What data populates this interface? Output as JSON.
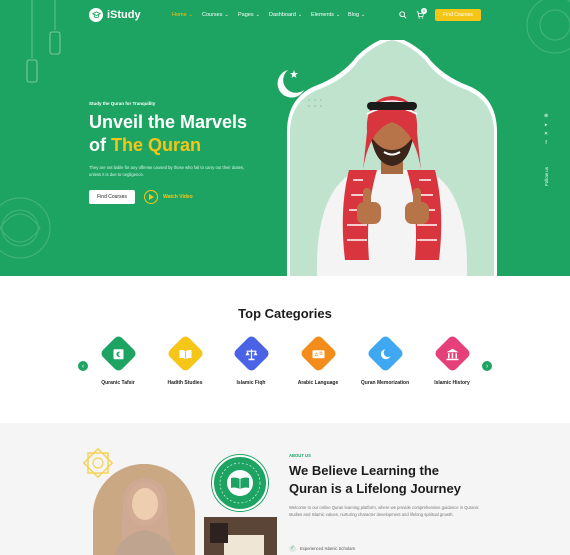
{
  "brand": {
    "name": "iStudy",
    "accent": "#1da462",
    "highlight": "#f5c518"
  },
  "nav": {
    "items": [
      {
        "label": "Home",
        "active": true
      },
      {
        "label": "Courses",
        "active": false
      },
      {
        "label": "Pages",
        "active": false
      },
      {
        "label": "Dashboard",
        "active": false
      },
      {
        "label": "Elements",
        "active": false
      },
      {
        "label": "Blog",
        "active": false
      }
    ],
    "cart_count": "0",
    "cta": "Find Courses"
  },
  "hero": {
    "kicker": "Study the Quran for Tranquility",
    "title_line1": "Unveil the Marvels",
    "title_line2_prefix": "of ",
    "title_line2_highlight": "The Quran",
    "description": "They are not liable for any offense caused by those who fail to carry out their duties, unless it is due to negligence.",
    "primary_button": "Find Courses",
    "video_button": "Watch Video",
    "follow_label": "Follow us"
  },
  "categories": {
    "title": "Top Categories",
    "items": [
      {
        "label": "Quranic Tafsir",
        "color": "#1da462",
        "icon": "quran-icon"
      },
      {
        "label": "Hadith Studies",
        "color": "#f5c518",
        "icon": "book-open-icon"
      },
      {
        "label": "Islamic Fiqh",
        "color": "#4a63e6",
        "icon": "scales-icon"
      },
      {
        "label": "Arabic Language",
        "color": "#f28c1a",
        "icon": "language-icon"
      },
      {
        "label": "Quran Memorization",
        "color": "#3fa8f0",
        "icon": "crescent-icon"
      },
      {
        "label": "Islamic History",
        "color": "#e6407a",
        "icon": "museum-icon"
      }
    ]
  },
  "about": {
    "tag": "ABOUT US",
    "title_line1": "We Believe Learning the",
    "title_line2": "Quran is a Lifelong Journey",
    "description": "Welcome to our online Quran learning platform, where we provide comprehensive guidance in Quranic studies and Islamic values, nurturing character development and lifelong spiritual growth.",
    "checklist": [
      "Experienced Islamic Scholars"
    ]
  }
}
